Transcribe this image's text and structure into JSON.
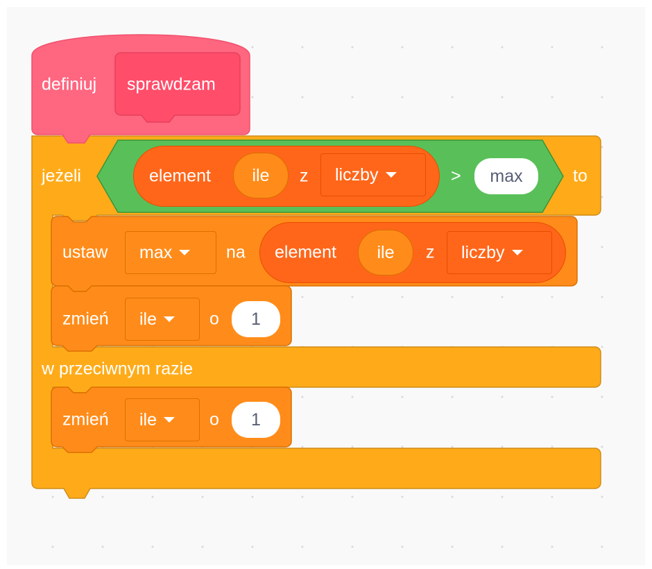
{
  "colors": {
    "myblocks": "#ff6680",
    "myblocks_dark": "#ff4d6a",
    "control": "#ffab19",
    "control_border": "#cf8b17",
    "variables": "#ff8c1a",
    "list_reporter": "#ff661a",
    "operators": "#59c059",
    "number_field": "#ffffff"
  },
  "define_block": {
    "label": "definiuj",
    "proc_name": "sprawdzam"
  },
  "if_else_block": {
    "if_label": "jeżeli",
    "then_label": "to",
    "else_label": "w przeciwnym razie",
    "condition": {
      "operator": ">",
      "left": {
        "item_label": "element",
        "index_var": "ile",
        "of_label": "z",
        "list_name": "liczby"
      },
      "right_value": "max"
    }
  },
  "set_block": {
    "label": "ustaw",
    "variable": "max",
    "to_label": "na",
    "value": {
      "item_label": "element",
      "index_var": "ile",
      "of_label": "z",
      "list_name": "liczby"
    }
  },
  "change_block_1": {
    "label": "zmień",
    "variable": "ile",
    "by_label": "o",
    "value": "1"
  },
  "change_block_2": {
    "label": "zmień",
    "variable": "ile",
    "by_label": "o",
    "value": "1"
  },
  "icons": {
    "dropdown": "caret-down-icon"
  }
}
